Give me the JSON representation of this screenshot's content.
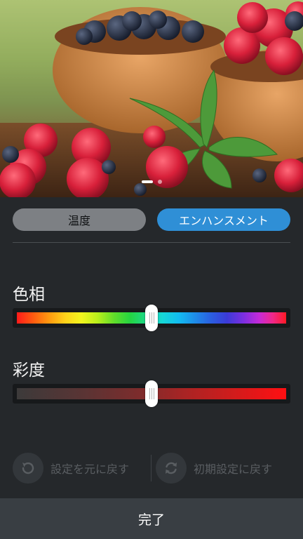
{
  "tabs": {
    "temperature_label": "温度",
    "enhancement_label": "エンハンスメント",
    "active": "enhancement"
  },
  "sliders": {
    "hue": {
      "label": "色相",
      "value": 0.5
    },
    "saturation": {
      "label": "彩度",
      "value": 0.5
    }
  },
  "actions": {
    "reset_label": "設定を元に戻す",
    "reset_icon": "undo-icon",
    "restore_defaults_label": "初期設定に戻す",
    "restore_defaults_icon": "refresh-icon"
  },
  "done_label": "完了",
  "preview": {
    "page_count": 2,
    "current_page": 1
  },
  "colors": {
    "accent": "#2f8fd6",
    "background": "#25282b",
    "done_bar": "#393e43"
  }
}
